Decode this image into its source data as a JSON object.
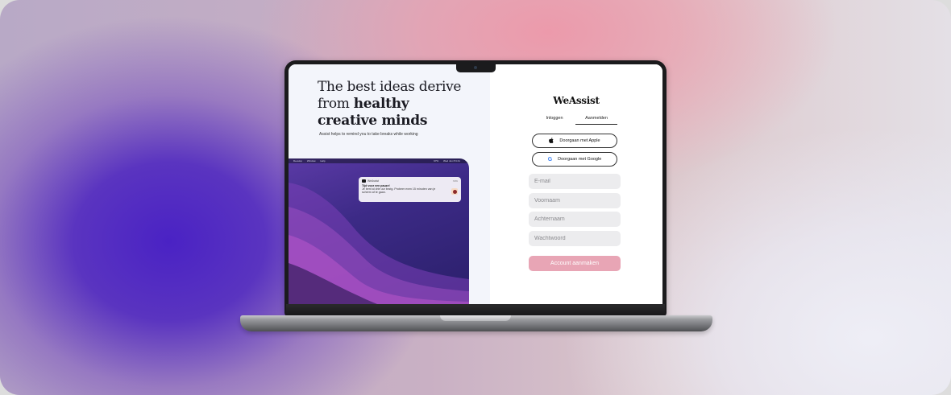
{
  "colors": {
    "accent": "#e8a5b5",
    "field_bg": "#ececee",
    "left_panel_bg": "#f3f5fb"
  },
  "hero": {
    "headline_line1": "The best ideas derive",
    "headline_line2_plain": "from ",
    "headline_line2_bold": "healthy",
    "headline_line3": "creative minds",
    "subline": "Assist helps to remind you to take breaks while working"
  },
  "mac": {
    "menubar_items": [
      "Develop",
      "Window",
      "Help"
    ],
    "menubar_right": [
      "97%",
      "Wed Jun 8 9:41"
    ],
    "notification": {
      "app_name": "WeAssist",
      "time": "now",
      "title": "Tijd voor een pauze!",
      "body": "Je bent al drie uur bezig. Probeer even 15 minuten van je scherm af te gaan."
    }
  },
  "auth": {
    "brand": "WeAssist",
    "tabs": [
      {
        "label": "Inloggen"
      },
      {
        "label": "Aanmelden"
      }
    ],
    "apple_button": "Doorgaan met Apple",
    "google_button": "Doorgaan met Google",
    "fields": {
      "email_placeholder": "E-mail",
      "first_name_placeholder": "Voornaam",
      "last_name_placeholder": "Achternaam",
      "password_placeholder": "Wachtwoord"
    },
    "submit_label": "Account aanmaken"
  }
}
